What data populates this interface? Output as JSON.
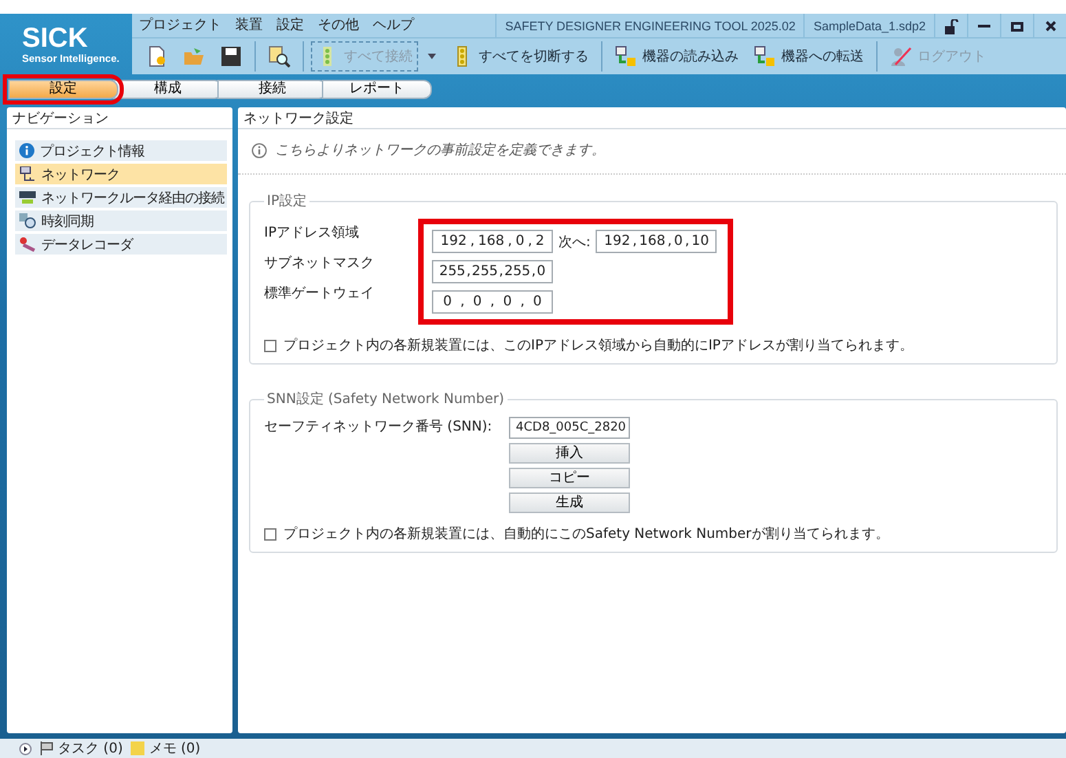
{
  "app": {
    "logo": "SICK",
    "tagline": "Sensor Intelligence.",
    "title": "SAFETY DESIGNER ENGINEERING TOOL 2025.02",
    "file": "SampleData_1.sdp2"
  },
  "menu": [
    "プロジェクト",
    "装置",
    "設定",
    "その他",
    "ヘルプ"
  ],
  "toolbar": [
    {
      "kind": "icon"
    },
    {
      "kind": "icon"
    },
    {
      "kind": "icon"
    },
    {
      "kind": "sep"
    },
    {
      "kind": "icon"
    },
    {
      "kind": "sep"
    },
    {
      "kind": "text",
      "label": "すべて接続",
      "disabled": true
    },
    {
      "kind": "caret"
    },
    {
      "kind": "text",
      "label": "すべてを切断する",
      "disabled": false
    },
    {
      "kind": "sep"
    },
    {
      "kind": "text",
      "label": "機器の読み込み",
      "disabled": false
    },
    {
      "kind": "text",
      "label": "機器への転送",
      "disabled": false
    },
    {
      "kind": "sep"
    },
    {
      "kind": "text",
      "label": "ログアウト",
      "disabled": true
    }
  ],
  "steps": [
    {
      "label": "設定",
      "selected": true
    },
    {
      "label": "構成",
      "selected": false
    },
    {
      "label": "接続",
      "selected": false
    },
    {
      "label": "レポート",
      "selected": false
    }
  ],
  "navigation": {
    "title": "ナビゲーション",
    "items": [
      {
        "label": "プロジェクト情報",
        "selected": false
      },
      {
        "label": "ネットワーク",
        "selected": true
      },
      {
        "label": "ネットワークルータ経由の接続",
        "selected": false
      },
      {
        "label": "時刻同期",
        "selected": false
      },
      {
        "label": "データレコーダ",
        "selected": false
      }
    ]
  },
  "panel": {
    "title": "ネットワーク設定",
    "info": "こちらよりネットワークの事前設定を定義できます。"
  },
  "ip_settings": {
    "title": "IP設定",
    "separator": ",",
    "rows": [
      {
        "label": "IPアドレス領域",
        "addresses": [
          [
            "192",
            "168",
            "0",
            "2"
          ],
          [
            "192",
            "168",
            "0",
            "10"
          ]
        ],
        "between": "次へ:"
      },
      {
        "label": "サブネットマスク",
        "addresses": [
          [
            "255",
            "255",
            "255",
            "0"
          ]
        ]
      },
      {
        "label": "標準ゲートウェイ",
        "addresses": [
          [
            "0",
            "0",
            "0",
            "0"
          ]
        ]
      }
    ],
    "auto_checkbox": {
      "label": "プロジェクト内の各新規装置には、このIPアドレス領域から自動的にIPアドレスが割り当てられます。",
      "checked": false
    }
  },
  "snn_settings": {
    "title": "SNN設定 (Safety Network Number)",
    "label": "セーフティネットワーク番号 (SNN):",
    "value": "4CD8_005C_2820",
    "buttons": [
      "挿入",
      "コピー",
      "生成"
    ],
    "auto_checkbox": {
      "label": "プロジェクト内の各新規装置には、自動的にこのSafety Network Numberが割り当てられます。",
      "checked": false
    }
  },
  "status_bar": {
    "tasks": "タスク (0)",
    "notes": "メモ (0)"
  }
}
